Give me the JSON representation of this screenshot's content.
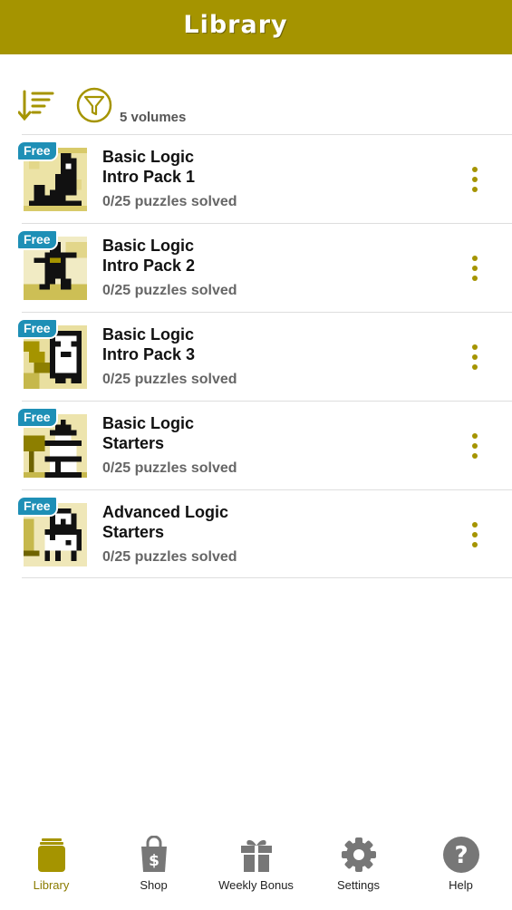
{
  "header": {
    "title": "Library"
  },
  "toolbar": {
    "volumes_count": "5 volumes"
  },
  "volumes": [
    {
      "badge": "Free",
      "title_line1": "Basic Logic",
      "title_line2": "Intro Pack 1",
      "status": "0/25 puzzles solved"
    },
    {
      "badge": "Free",
      "title_line1": "Basic Logic",
      "title_line2": "Intro Pack 2",
      "status": "0/25 puzzles solved"
    },
    {
      "badge": "Free",
      "title_line1": "Basic Logic",
      "title_line2": "Intro Pack 3",
      "status": "0/25 puzzles solved"
    },
    {
      "badge": "Free",
      "title_line1": "Basic Logic",
      "title_line2": "Starters",
      "status": "0/25 puzzles solved"
    },
    {
      "badge": "Free",
      "title_line1": "Advanced Logic",
      "title_line2": "Starters",
      "status": "0/25 puzzles solved"
    }
  ],
  "bottom_nav": [
    {
      "label": "Library",
      "icon": "library-icon",
      "active": true
    },
    {
      "label": "Shop",
      "icon": "shopping-bag-icon",
      "active": false
    },
    {
      "label": "Weekly Bonus",
      "icon": "gift-icon",
      "active": false
    },
    {
      "label": "Settings",
      "icon": "gear-icon",
      "active": false
    },
    {
      "label": "Help",
      "icon": "help-icon",
      "active": false
    }
  ],
  "colors": {
    "accent": "#a59400",
    "badge": "#1e8fb6",
    "nav_inactive": "#777777"
  }
}
